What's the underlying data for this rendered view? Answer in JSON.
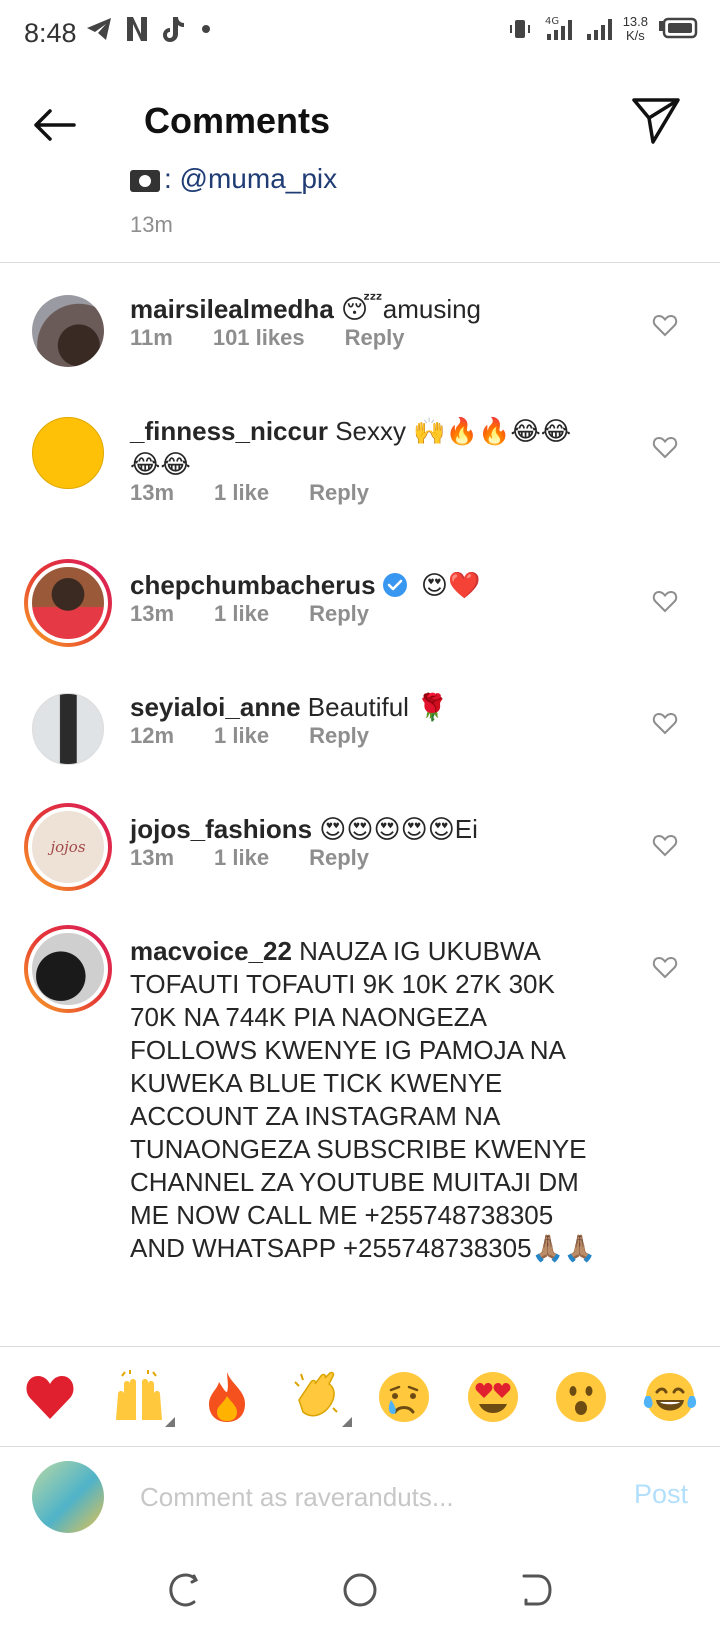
{
  "status_bar": {
    "time": "8:48",
    "net_speed_value": "13.8",
    "net_speed_unit": "K/s",
    "network_type": "4G"
  },
  "header": {
    "title": "Comments"
  },
  "caption_tail": {
    "credit": ": @muma_pix",
    "time": "13m"
  },
  "comments": [
    {
      "username": "mairsilealmedha",
      "emoji_prefix": "😴",
      "text": "amusing",
      "time": "11m",
      "likes": "101 likes",
      "reply": "Reply"
    },
    {
      "username": "_finness_niccur",
      "text": " Sexxy 🙌🔥🔥😂😂😂😂",
      "time": "13m",
      "likes": "1 like",
      "reply": "Reply"
    },
    {
      "username": "chepchumbacherus",
      "text": " 😍❤️",
      "time": "13m",
      "likes": "1 like",
      "reply": "Reply",
      "verified": true
    },
    {
      "username": "seyialoi_anne",
      "text": " Beautiful 🌹",
      "time": "12m",
      "likes": "1 like",
      "reply": "Reply"
    },
    {
      "username": "jojos_fashions",
      "text": " 😍😍😍😍😍Ei",
      "time": "13m",
      "likes": "1 like",
      "reply": "Reply",
      "avatar_text": "jojos"
    },
    {
      "username": "macvoice_22",
      "text": " NAUZA IG UKUBWA TOFAUTI TOFAUTI  9K 10K 27K 30K 70K NA 744K PIA NAONGEZA FOLLOWS KWENYE IG PAMOJA NA KUWEKA BLUE TICK KWENYE ACCOUNT ZA INSTAGRAM NA TUNAONGEZA SUBSCRIBE KWENYE CHANNEL ZA YOUTUBE MUITAJI DM ME NOW CALL ME +255748738305 AND WHATSAPP +255748738305🙏🏽🙏🏽"
    }
  ],
  "quick_emojis": [
    {
      "icon": "red-heart-icon"
    },
    {
      "icon": "raising-hands-icon"
    },
    {
      "icon": "fire-icon"
    },
    {
      "icon": "clapping-hands-icon"
    },
    {
      "icon": "crying-face-icon"
    },
    {
      "icon": "heart-eyes-icon"
    },
    {
      "icon": "surprised-face-icon"
    },
    {
      "icon": "laughing-tears-icon"
    }
  ],
  "input_bar": {
    "placeholder": "Comment as raveranduts...",
    "post_label": "Post"
  },
  "colors": {
    "link": "#1f3c75",
    "meta": "#8e8e8e",
    "post_disabled": "#b2dffc",
    "verified": "#3897f0"
  }
}
